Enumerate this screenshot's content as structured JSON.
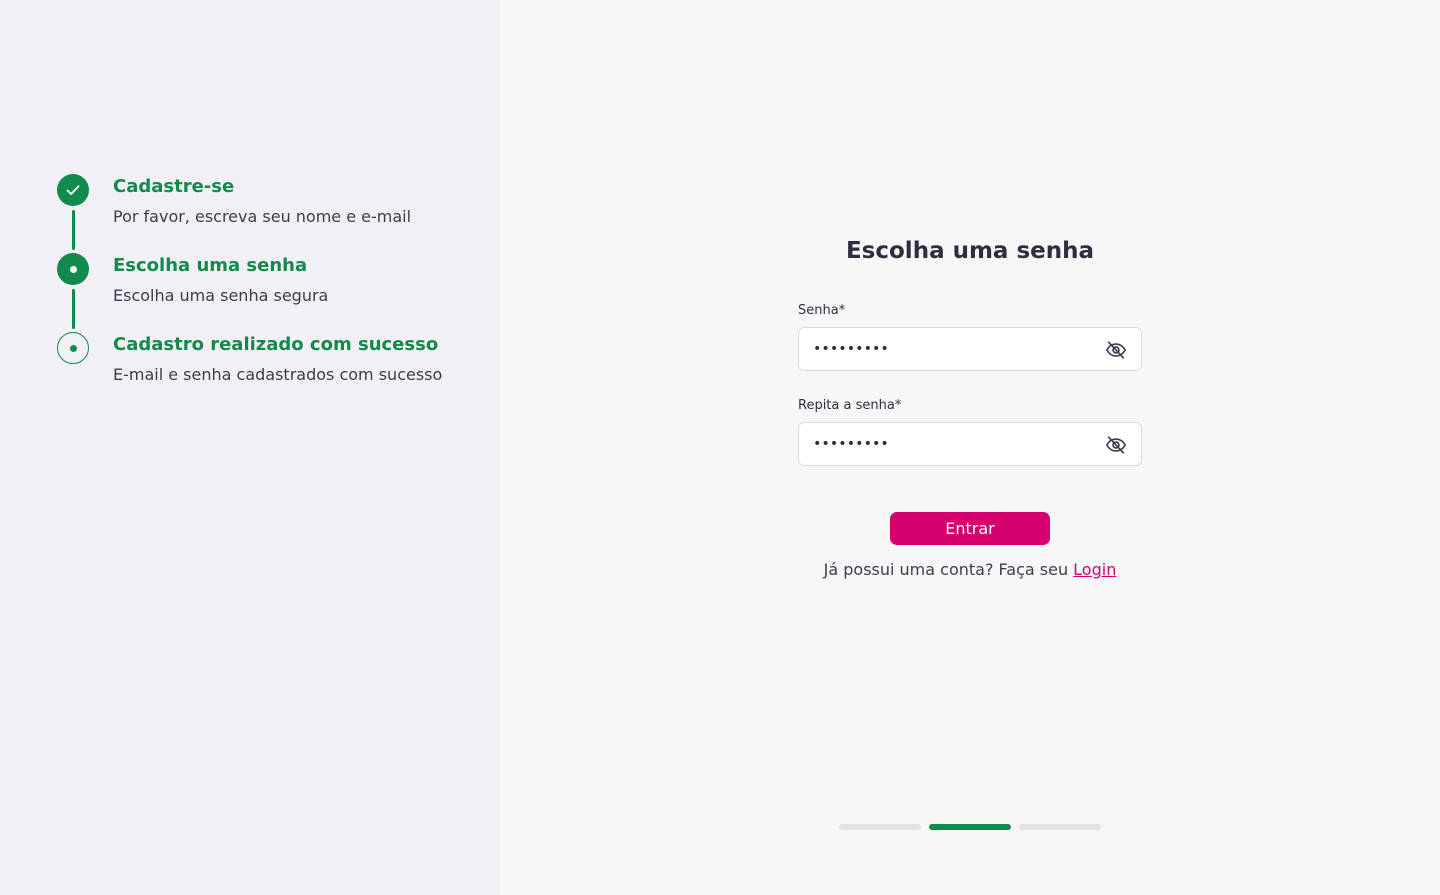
{
  "steps": [
    {
      "title": "Cadastre-se",
      "description": "Por favor, escreva seu nome e e-mail",
      "state": "done"
    },
    {
      "title": "Escolha uma senha",
      "description": "Escolha uma senha segura",
      "state": "current"
    },
    {
      "title": "Cadastro realizado com sucesso",
      "description": "E-mail e senha cadastrados com sucesso",
      "state": "upcoming"
    }
  ],
  "form": {
    "title": "Escolha uma senha",
    "password_label": "Senha*",
    "password_value": "•••••••••",
    "confirm_label": "Repita a senha*",
    "confirm_value": "•••••••••",
    "submit_label": "Entrar",
    "login_prompt": "Já possui uma conta? Faça seu ",
    "login_link": "Login"
  },
  "progress": {
    "current_step": 2,
    "total_steps": 3
  },
  "colors": {
    "primary_green": "#128a4b",
    "accent_pink": "#d6006f",
    "sidebar_bg": "#f0f0f5",
    "page_bg": "#f7f7f7",
    "text_dark": "#2f2e41"
  },
  "icons": {
    "done_step": "check-icon",
    "current_step": "dot-icon",
    "toggle_visibility": "eye-off-icon"
  }
}
